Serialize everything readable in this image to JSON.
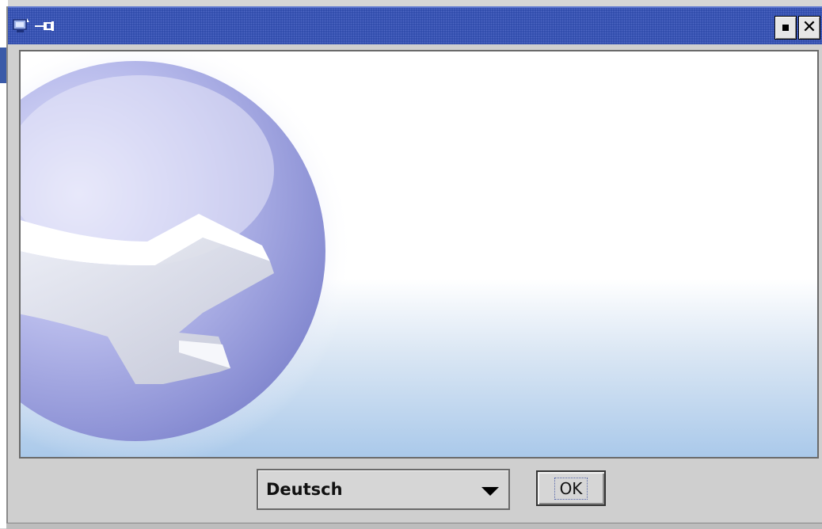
{
  "window": {
    "title": "",
    "app_icon": "java-app-icon",
    "pin_icon": "pin-icon",
    "controls": {
      "maximize_icon": "maximize-icon",
      "close_icon": "close-icon",
      "close_glyph": "✕"
    }
  },
  "splash": {
    "logo_icon": "wrench-globe-logo"
  },
  "footer": {
    "language_select": {
      "selected": "Deutsch",
      "arrow_icon": "chevron-down-icon"
    },
    "ok_button": {
      "label": "OK"
    }
  },
  "colors": {
    "titlebar": "#2c48a8",
    "window_bg": "#cfcfcf",
    "globe": "#8f95d6",
    "gradient_bottom": "#aac9ea"
  }
}
